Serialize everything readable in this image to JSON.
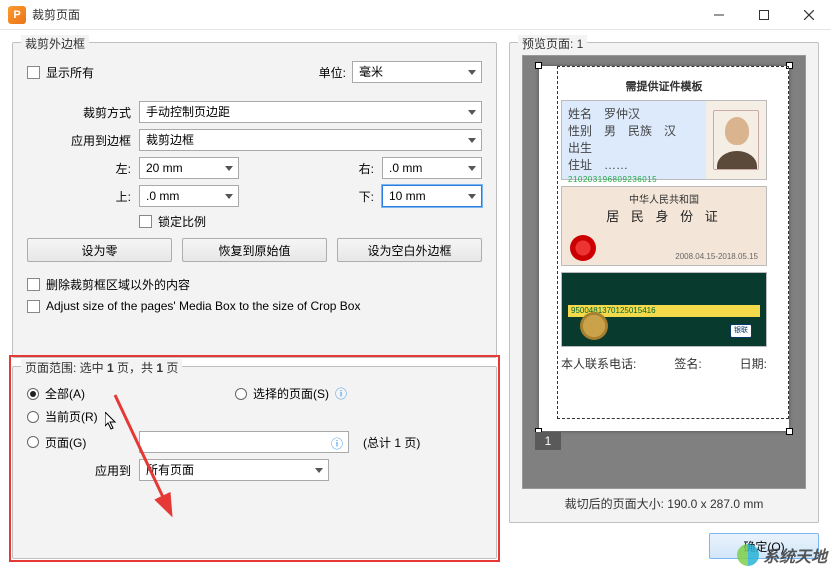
{
  "window": {
    "title": "裁剪页面"
  },
  "group_crop": {
    "legend": "裁剪外边框",
    "show_all": "显示所有",
    "unit_label": "单位:",
    "unit_value": "毫米",
    "crop_mode_label": "裁剪方式",
    "crop_mode_value": "手动控制页边距",
    "apply_to_border_label": "应用到边框",
    "apply_to_border_value": "裁剪边框",
    "left_label": "左:",
    "left_value": "20 mm",
    "right_label": "右:",
    "right_value": ".0 mm",
    "top_label": "上:",
    "top_value": ".0 mm",
    "bottom_label": "下:",
    "bottom_value": "10 mm",
    "lock_ratio": "锁定比例",
    "btn_zero": "设为零",
    "btn_reset": "恢复到原始值",
    "btn_blank": "设为空白外边框",
    "del_outside": "删除裁剪框区域以外的内容",
    "adjust_media": "Adjust size of the pages' Media Box to the size of Crop Box"
  },
  "group_range": {
    "legend_prefix": "页面范围: 选中 ",
    "legend_bold1": "1",
    "legend_mid": " 页，共 ",
    "legend_bold2": "1",
    "legend_suffix": " 页",
    "all": "全部(A)",
    "selected_pages": "选择的页面(S)",
    "current": "当前页(R)",
    "pages": "页面(G)",
    "pages_input": "",
    "total": "(总计 1 页)",
    "apply_to_label": "应用到",
    "apply_to_value": "所有页面"
  },
  "preview": {
    "legend": "预览页面: 1",
    "doc_title": "需提供证件模板",
    "barcode": "210203196809236015",
    "card2_line1": "中华人民共和国",
    "card2_line2": "居 民 身 份 证",
    "card2_date": "2008.04.15-2018.05.15",
    "card3_strip": "9500481370125015416",
    "unionpay": "银联",
    "footer_phone": "本人联系电话:",
    "footer_sign": "签名:",
    "footer_date": "日期:",
    "page_num": "1",
    "crop_size": "裁切后的页面大小: 190.0 x 287.0 mm"
  },
  "ok": "确定(O)",
  "watermark": "系统天地"
}
